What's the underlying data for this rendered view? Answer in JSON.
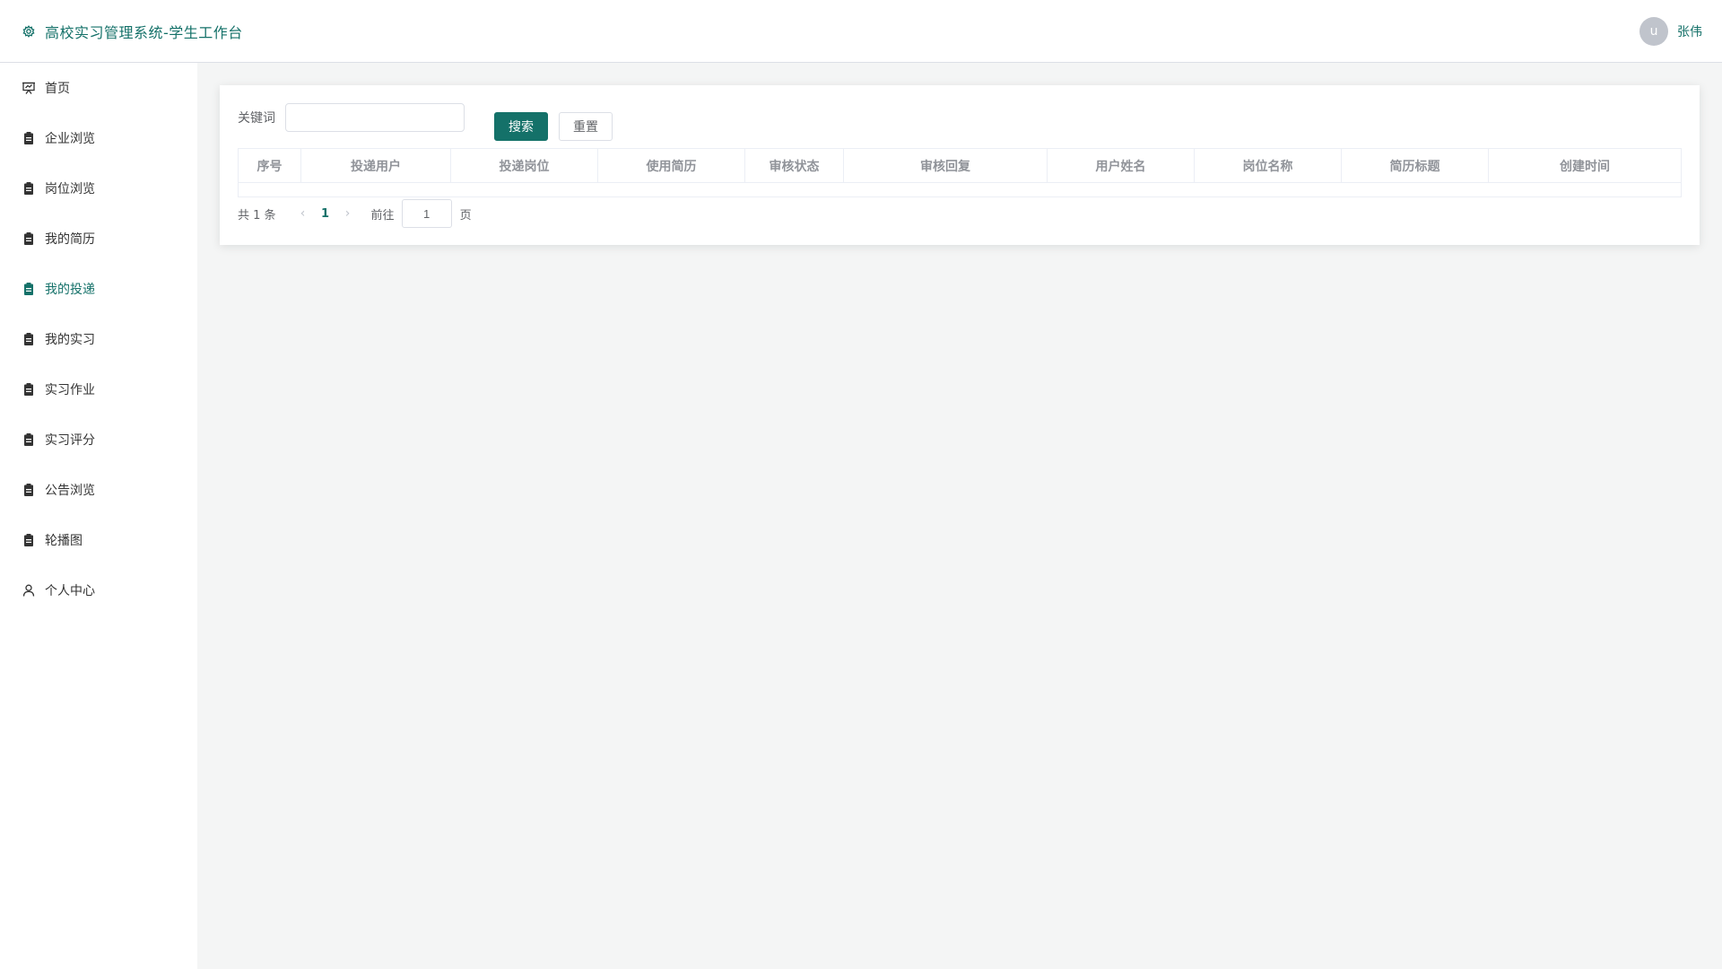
{
  "header": {
    "title": "高校实习管理系统-学生工作台",
    "avatar_text": "u",
    "username": "张伟"
  },
  "sidebar": {
    "items": [
      {
        "label": "首页",
        "icon": "presentation-icon"
      },
      {
        "label": "企业浏览",
        "icon": "clipboard-icon"
      },
      {
        "label": "岗位浏览",
        "icon": "clipboard-icon"
      },
      {
        "label": "我的简历",
        "icon": "clipboard-icon"
      },
      {
        "label": "我的投递",
        "icon": "clipboard-icon",
        "active": true
      },
      {
        "label": "我的实习",
        "icon": "clipboard-icon"
      },
      {
        "label": "实习作业",
        "icon": "clipboard-icon"
      },
      {
        "label": "实习评分",
        "icon": "clipboard-icon"
      },
      {
        "label": "公告浏览",
        "icon": "clipboard-icon"
      },
      {
        "label": "轮播图",
        "icon": "clipboard-icon"
      },
      {
        "label": "个人中心",
        "icon": "user-icon"
      }
    ]
  },
  "search": {
    "keyword_label": "关键词",
    "keyword_value": "",
    "search_label": "搜索",
    "reset_label": "重置"
  },
  "table": {
    "columns": [
      "序号",
      "投递用户",
      "投递岗位",
      "使用简历",
      "审核状态",
      "审核回复",
      "用户姓名",
      "岗位名称",
      "简历标题",
      "创建时间"
    ],
    "rows": []
  },
  "pagination": {
    "total_text": "共 1 条",
    "current_page": "1",
    "goto_label": "前往",
    "goto_value": "1",
    "page_suffix": "页"
  },
  "colors": {
    "accent": "#147169",
    "background": "#f4f5f5"
  }
}
